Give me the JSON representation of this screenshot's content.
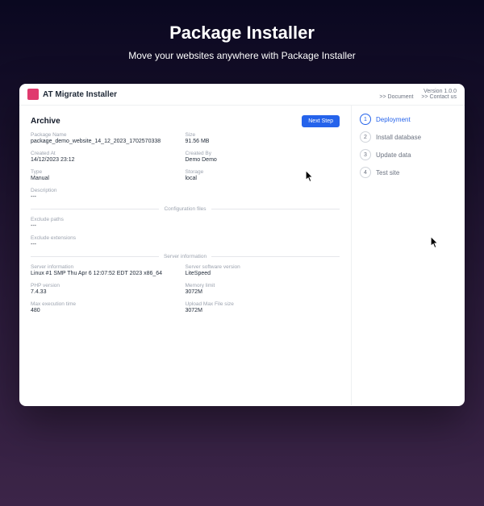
{
  "hero": {
    "title": "Package Installer",
    "subtitle": "Move your websites anywhere with Package Installer"
  },
  "topbar": {
    "app_title": "AT Migrate Installer",
    "version": "Version 1.0.0",
    "doc_link": ">> Document",
    "contact_link": ">> Contact us"
  },
  "archive": {
    "title": "Archive",
    "next_step": "Next Step",
    "package_name_label": "Package Name",
    "package_name": "package_demo_website_14_12_2023_1702570338",
    "size_label": "Size",
    "size": "91.56 MB",
    "created_at_label": "Created At",
    "created_at": "14/12/2023 23:12",
    "created_by_label": "Created By",
    "created_by": "Demo Demo",
    "type_label": "Type",
    "type": "Manual",
    "storage_label": "Storage",
    "storage": "local",
    "description_label": "Description",
    "description": "---"
  },
  "config": {
    "divider": "Configuration files",
    "exclude_paths_label": "Exclude paths",
    "exclude_paths": "---",
    "exclude_ext_label": "Exclude extensions",
    "exclude_ext": "---"
  },
  "server": {
    "divider": "Server information",
    "info_label": "Server information",
    "info": "Linux #1 SMP Thu Apr 6 12:07:52 EDT 2023 x86_64",
    "software_label": "Server software version",
    "software": "LiteSpeed",
    "php_label": "PHP version",
    "php": "7.4.33",
    "mem_label": "Memory limit",
    "mem": "3072M",
    "exec_label": "Max execution time",
    "exec": "480",
    "upload_label": "Upload Max File size",
    "upload": "3072M"
  },
  "steps": [
    {
      "num": "1",
      "label": "Deployment"
    },
    {
      "num": "2",
      "label": "Install database"
    },
    {
      "num": "3",
      "label": "Update data"
    },
    {
      "num": "4",
      "label": "Test site"
    }
  ]
}
